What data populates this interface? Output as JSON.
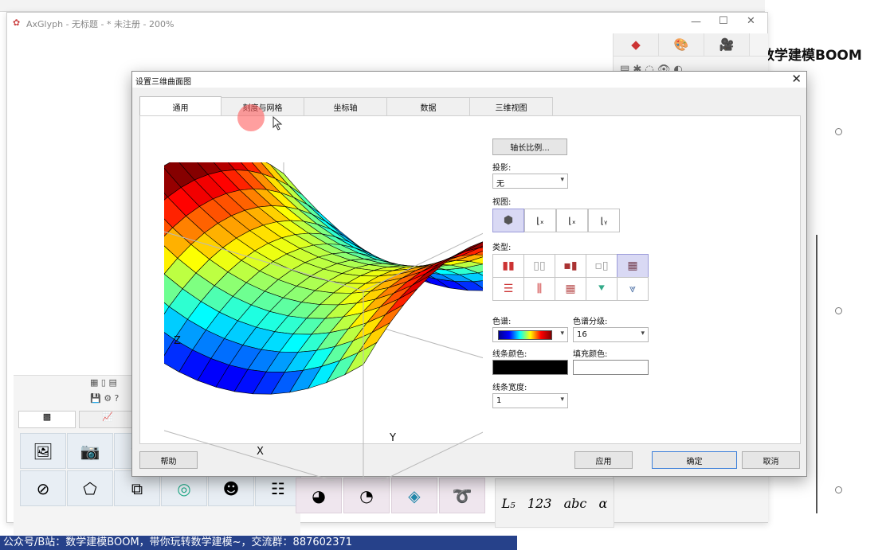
{
  "app": {
    "title": "AxGlyph - 无标题 - * 未注册 - 200%",
    "right_title": "数学建模BOOM",
    "bottom_banner": "公众号/B站：数学建模BOOM，带你玩转数学建模~，交流群：887602371",
    "math_symbols": [
      "L₅",
      "123",
      "abc",
      "α"
    ]
  },
  "dialog": {
    "title": "设置三维曲面图",
    "tabs": [
      {
        "label": "通用",
        "active": true
      },
      {
        "label": "刻度与网格",
        "active": false
      },
      {
        "label": "坐标轴",
        "active": false
      },
      {
        "label": "数据",
        "active": false
      },
      {
        "label": "三维视图",
        "active": false
      }
    ],
    "axis_scale_button": "轴长比例...",
    "projection": {
      "label": "投影:",
      "value": "无"
    },
    "view": {
      "label": "视图:"
    },
    "type": {
      "label": "类型:"
    },
    "colormap": {
      "label": "色谱:"
    },
    "colormap_levels": {
      "label": "色谱分级:",
      "value": "16"
    },
    "line_color": {
      "label": "线条颜色:",
      "value": "#000000"
    },
    "fill_color": {
      "label": "填充颜色:",
      "value": "#ffffff"
    },
    "line_width": {
      "label": "线条宽度:",
      "value": "1"
    },
    "buttons": {
      "help": "帮助",
      "apply": "应用",
      "ok": "确定",
      "cancel": "取消"
    },
    "axis_labels": {
      "x": "X",
      "y": "Y",
      "z": "Z"
    }
  }
}
